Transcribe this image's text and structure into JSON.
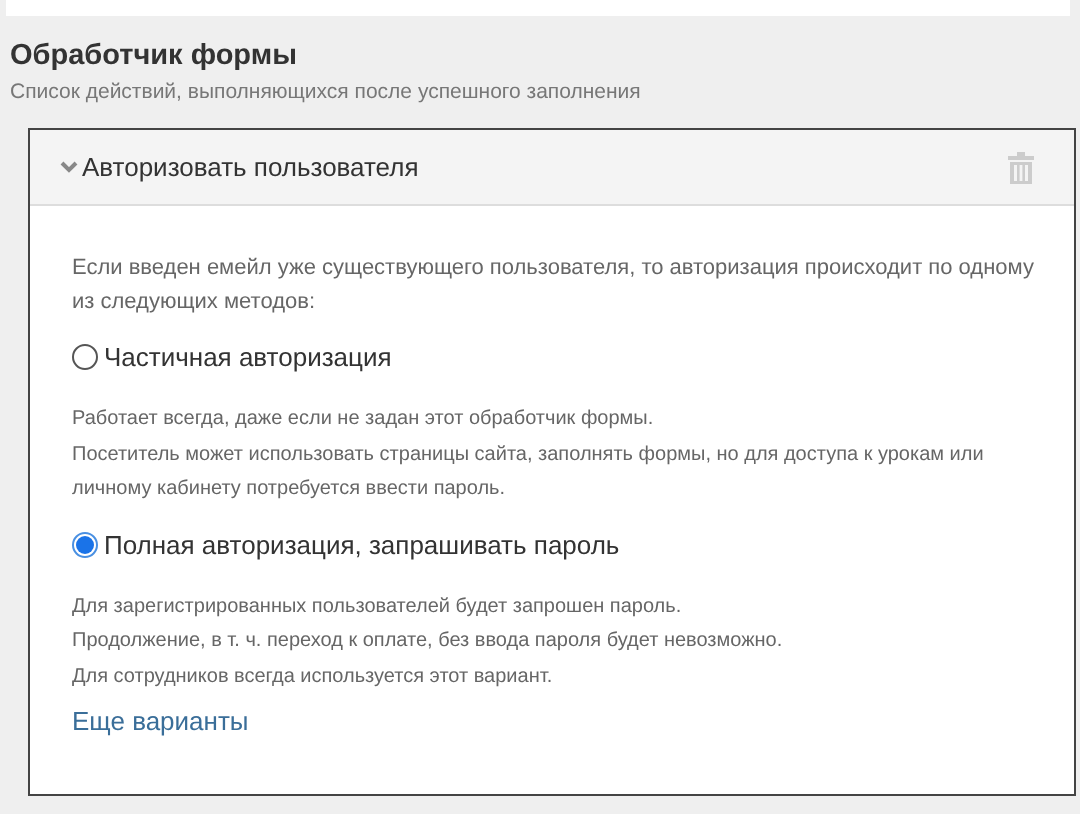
{
  "section": {
    "title": "Обработчик формы",
    "subtitle": "Список действий, выполняющихся после успешного заполнения"
  },
  "handler": {
    "title": "Авторизовать пользователя",
    "expanded": true,
    "intro": [
      "Если введен емейл уже существующего пользователя, то авторизация происходит по одному из следующих методов:"
    ],
    "options": [
      {
        "label": "Частичная авторизация",
        "selected": false,
        "description": [
          "Работает всегда, даже если не задан этот обработчик формы.",
          "Посетитель может использовать страницы сайта, заполнять формы, но для доступа к урокам или личному кабинету потребуется ввести пароль."
        ]
      },
      {
        "label": "Полная авторизация, запрашивать пароль",
        "selected": true,
        "description": [
          "Для зарегистрированных пользователей будет запрошен пароль.",
          "Продолжение, в т. ч. переход к оплате, без ввода пароля будет невозможно.",
          "Для сотрудников всегда используется этот вариант."
        ]
      }
    ],
    "more_link": "Еще варианты"
  }
}
